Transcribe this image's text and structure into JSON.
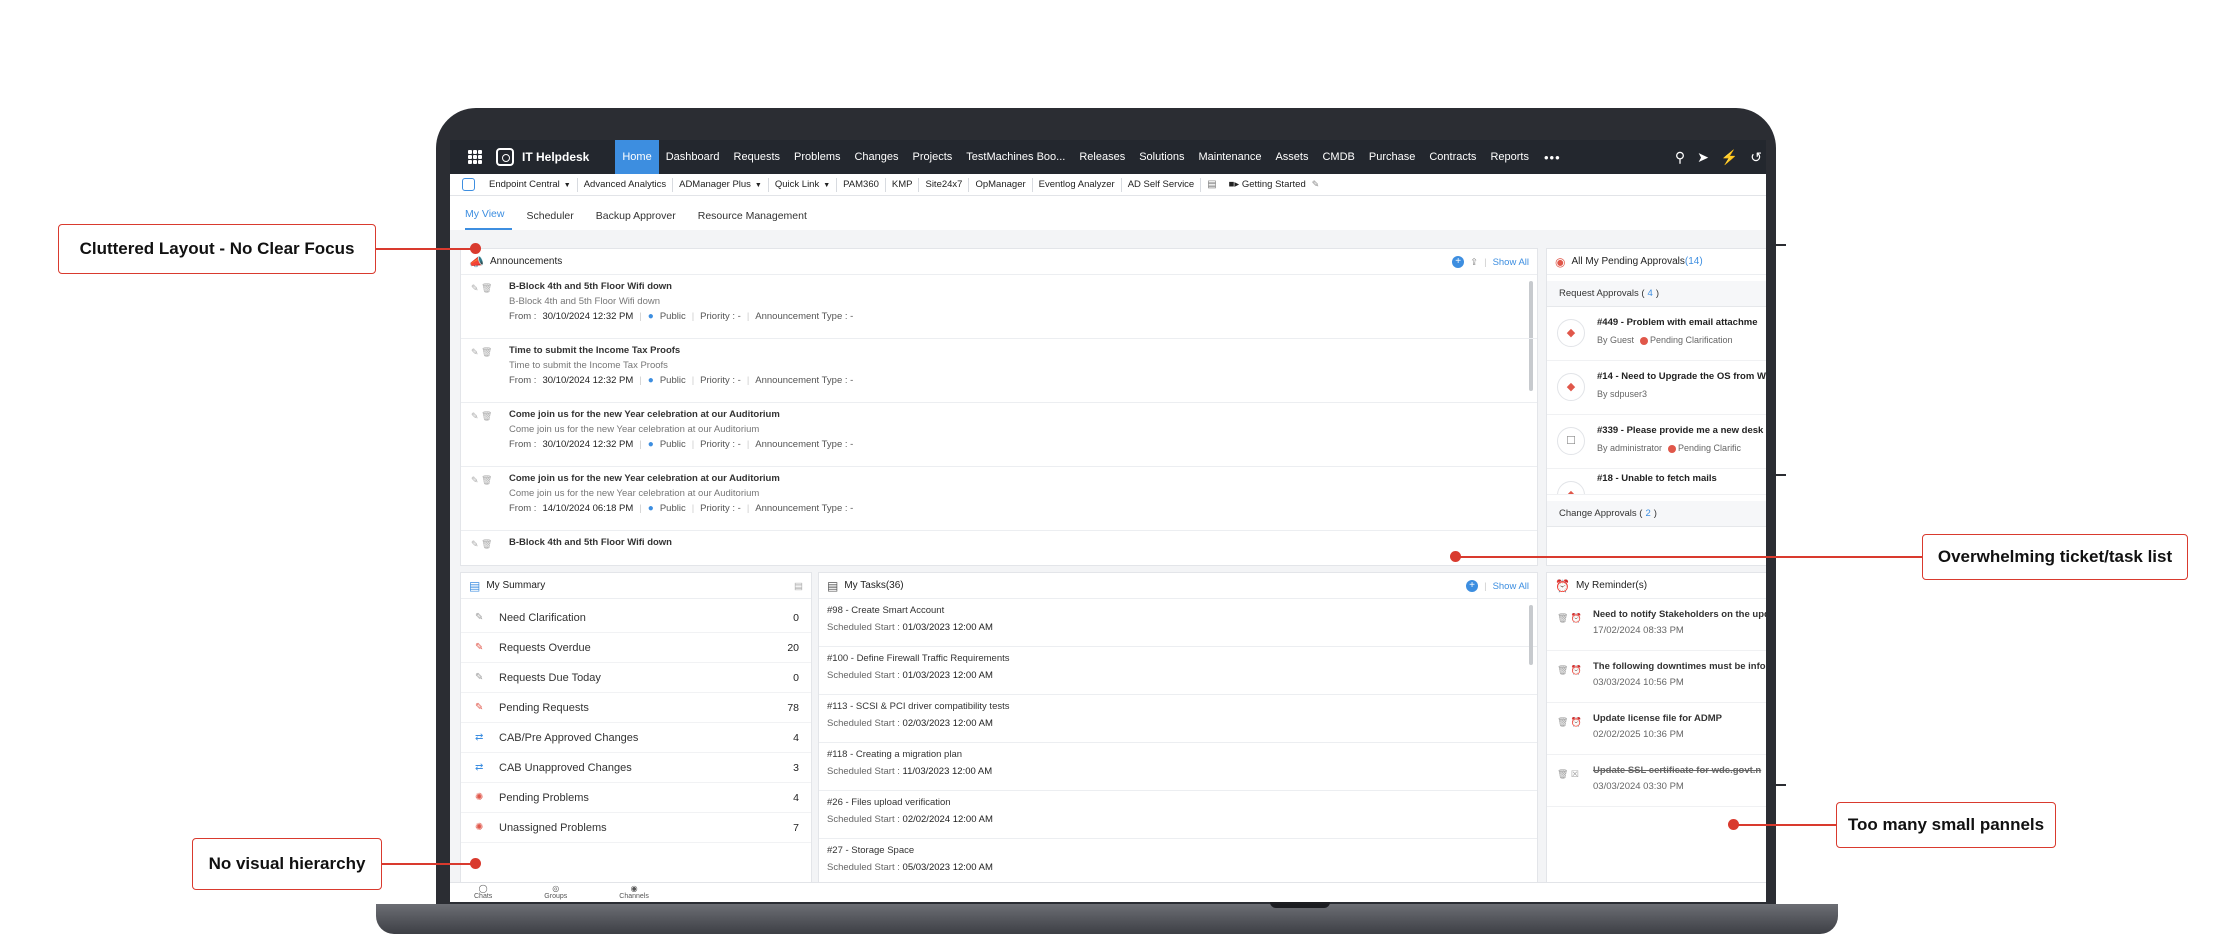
{
  "nav": {
    "app_title": "IT Helpdesk",
    "items": [
      "Home",
      "Dashboard",
      "Requests",
      "Problems",
      "Changes",
      "Projects",
      "TestMachines Boo...",
      "Releases",
      "Solutions",
      "Maintenance",
      "Assets",
      "CMDB",
      "Purchase",
      "Contracts",
      "Reports"
    ],
    "more": "•••",
    "icons": [
      "search-icon",
      "rocket-icon",
      "lightning-icon",
      "history-icon"
    ]
  },
  "toolbar": {
    "items": [
      "Endpoint Central",
      "Advanced Analytics",
      "ADManager Plus",
      "Quick Link",
      "PAM360",
      "KMP",
      "Site24x7",
      "OpManager",
      "Eventlog Analyzer",
      "AD Self Service"
    ],
    "getting_started": "Getting Started"
  },
  "view_tabs": [
    "My View",
    "Scheduler",
    "Backup Approver",
    "Resource Management"
  ],
  "announcements": {
    "title": "Announcements",
    "show_all": "Show All",
    "from_label": "From :",
    "public_label": "Public",
    "priority_label": "Priority : -",
    "type_label": "Announcement Type : -",
    "items": [
      {
        "title": "B-Block 4th and 5th Floor Wifi down",
        "desc": "B-Block 4th and 5th Floor Wifi down",
        "date": "30/10/2024 12:32 PM"
      },
      {
        "title": "Time to submit the Income Tax Proofs",
        "desc": "Time to submit the Income Tax Proofs",
        "date": "30/10/2024 12:32 PM"
      },
      {
        "title": "Come join us for the new Year celebration at our Auditorium",
        "desc": "Come join us for the new Year celebration at our Auditorium",
        "date": "30/10/2024 12:32 PM"
      },
      {
        "title": "Come join us for the new Year celebration at our Auditorium",
        "desc": "Come join us for the new Year celebration at our Auditorium",
        "date": "14/10/2024 06:18 PM"
      },
      {
        "title": "B-Block 4th and 5th Floor Wifi down",
        "desc": "",
        "date": ""
      }
    ]
  },
  "approvals": {
    "title": "All My Pending Approvals",
    "count": "(14)",
    "request_label": "Request Approvals (",
    "request_count": "4",
    "close_paren": ")",
    "change_label": "Change Approvals (",
    "change_count": "2",
    "items": [
      {
        "title": "#449 - Problem with email attachme",
        "by": "By Guest",
        "status": "Pending Clarification"
      },
      {
        "title": "#14 - Need to Upgrade the OS from W",
        "by": "By sdpuser3",
        "status": ""
      },
      {
        "title": "#339 - Please provide me a new desk",
        "by": "By administrator",
        "status": "Pending Clarific"
      },
      {
        "title": "#18 - Unable to fetch mails",
        "by": "",
        "status": ""
      }
    ]
  },
  "summary": {
    "title": "My Summary",
    "rows": [
      {
        "label": "Need Clarification",
        "value": "0"
      },
      {
        "label": "Requests Overdue",
        "value": "20"
      },
      {
        "label": "Requests Due Today",
        "value": "0"
      },
      {
        "label": "Pending Requests",
        "value": "78"
      },
      {
        "label": "CAB/Pre Approved Changes",
        "value": "4"
      },
      {
        "label": "CAB Unapproved Changes",
        "value": "3"
      },
      {
        "label": "Pending Problems",
        "value": "4"
      },
      {
        "label": "Unassigned Problems",
        "value": "7"
      }
    ]
  },
  "tasks": {
    "title": "My Tasks(36)",
    "show_all": "Show All",
    "start_label": "Scheduled Start :",
    "items": [
      {
        "title": "#98 - Create Smart Account",
        "date": "01/03/2023 12:00 AM"
      },
      {
        "title": "#100 - Define Firewall Traffic Requirements",
        "date": "01/03/2023 12:00 AM"
      },
      {
        "title": "#113 - SCSI & PCI driver compatibility tests",
        "date": "02/03/2023 12:00 AM"
      },
      {
        "title": "#118 - Creating a migration plan",
        "date": "11/03/2023 12:00 AM"
      },
      {
        "title": "#26 - Files upload verification",
        "date": "02/02/2024 12:00 AM"
      },
      {
        "title": "#27 - Storage Space",
        "date": "05/03/2023 12:00 AM"
      }
    ]
  },
  "reminders": {
    "title": "My Reminder(s)",
    "items": [
      {
        "title": "Need to notify Stakeholders on the upd",
        "date": "17/02/2024 08:33 PM",
        "done": false
      },
      {
        "title": "The following downtimes must be info",
        "date": "03/03/2024 10:56 PM",
        "done": false
      },
      {
        "title": "Update license file for ADMP",
        "date": "02/02/2025 10:36 PM",
        "done": false
      },
      {
        "title": "Update SSL certificate for wdc.govt.n",
        "date": "03/03/2024 03:30 PM",
        "done": true
      }
    ]
  },
  "bottom_bar": [
    "Chats",
    "Groups",
    "Channels"
  ],
  "callouts": {
    "cluttered": "Cluttered Layout - No Clear Focus",
    "overwhelming": "Overwhelming ticket/task list",
    "hierarchy": "No visual hierarchy",
    "panels": "Too many small pannels"
  },
  "colors": {
    "accent": "#3d8ee0",
    "callout_red": "#d93a2e",
    "nav_bg": "#23272e"
  }
}
